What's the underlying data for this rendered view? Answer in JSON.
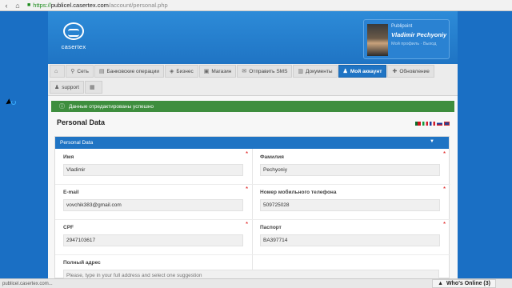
{
  "browser": {
    "url_scheme": "https://",
    "url_host": "publicel.casertex.com",
    "url_path": "/account/personal.php"
  },
  "header": {
    "logo_text": "casertex",
    "profile": {
      "brand": "Publipoint",
      "name": "Vladimir Pechyoniy",
      "links": "Мой профиль · Выход"
    }
  },
  "tabs": {
    "row1": [
      {
        "icon": "home-icon",
        "glyph": "⌂",
        "label": ""
      },
      {
        "icon": "network-icon",
        "glyph": "⚲",
        "label": "Сеть"
      },
      {
        "icon": "bank-icon",
        "glyph": "▤",
        "label": "Банковские операции"
      },
      {
        "icon": "tag-icon",
        "glyph": "◈",
        "label": "Бизнес"
      },
      {
        "icon": "cart-icon",
        "glyph": "▣",
        "label": "Магазин"
      },
      {
        "icon": "mail-icon",
        "glyph": "✉",
        "label": "Отправить SMS"
      },
      {
        "icon": "document-icon",
        "glyph": "▥",
        "label": "Документы"
      },
      {
        "icon": "user-icon",
        "glyph": "♟",
        "label": "Мой аккаунт"
      },
      {
        "icon": "refresh-icon",
        "glyph": "✚",
        "label": "Обновление"
      }
    ],
    "row2": [
      {
        "icon": "support-icon",
        "glyph": "♟",
        "label": "support"
      },
      {
        "icon": "notes-icon",
        "glyph": "▦",
        "label": ""
      }
    ],
    "active": "Мой аккаунт"
  },
  "alert": {
    "text": "Данные отредактированы успешно"
  },
  "page_title": "Personal Data",
  "panel": {
    "title": "Personal Data",
    "fields": {
      "first_name": {
        "label": "Имя",
        "value": "Vladimir"
      },
      "last_name": {
        "label": "Фамилия",
        "value": "Pechyoniy"
      },
      "email": {
        "label": "E-mail",
        "value": "vovchik383@gmail.com"
      },
      "mobile": {
        "label": "Номер мобильного телефона",
        "value": "509725028"
      },
      "cpf": {
        "label": "CPF",
        "value": "2947103617"
      },
      "passport": {
        "label": "Паспорт",
        "value": "BA397714"
      },
      "address": {
        "label": "Полный адрес",
        "placeholder": "Please, type in your full address and select one suggestion"
      }
    }
  },
  "status_bar": {
    "text": "publicel.casertex.com..."
  },
  "whos_online": {
    "label": "Who's Online (3)"
  },
  "colors": {
    "brand_blue": "#1f74c4",
    "success_green": "#3e8e3e",
    "required_red": "#d11111"
  }
}
